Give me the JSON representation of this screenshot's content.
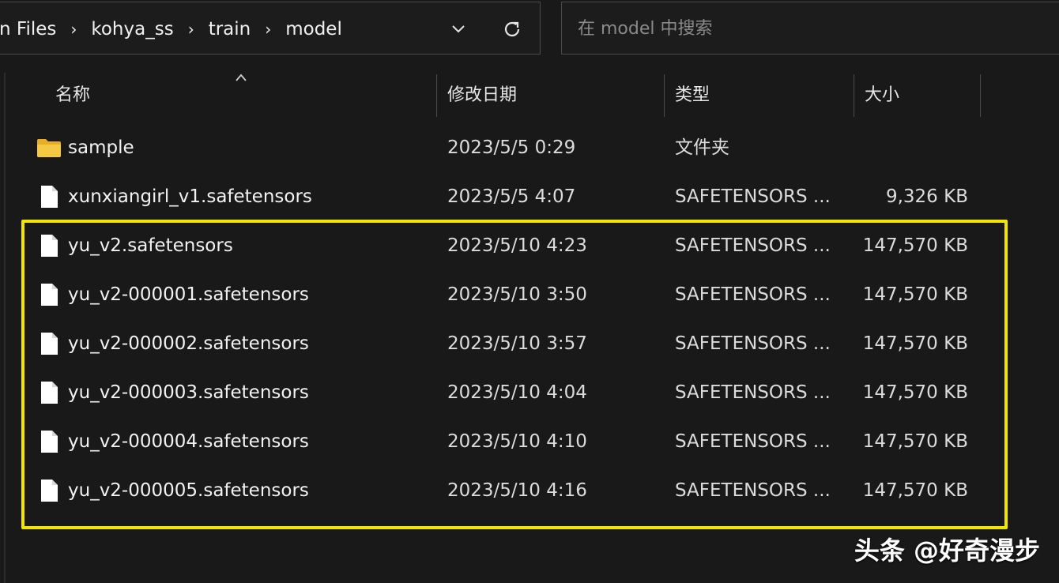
{
  "address": {
    "crumbs": [
      "n Files",
      "kohya_ss",
      "train",
      "model"
    ],
    "separator": "›"
  },
  "search": {
    "placeholder": "在 model 中搜索"
  },
  "columns": {
    "name": "名称",
    "date": "修改日期",
    "type": "类型",
    "size": "大小"
  },
  "files": [
    {
      "name": "sample",
      "date": "2023/5/5 0:29",
      "type": "文件夹",
      "size": "",
      "icon": "folder-icon"
    },
    {
      "name": "xunxiangirl_v1.safetensors",
      "date": "2023/5/5 4:07",
      "type": "SAFETENSORS ...",
      "size": "9,326 KB",
      "icon": "file-icon"
    },
    {
      "name": "yu_v2.safetensors",
      "date": "2023/5/10 4:23",
      "type": "SAFETENSORS ...",
      "size": "147,570 KB",
      "icon": "file-icon"
    },
    {
      "name": "yu_v2-000001.safetensors",
      "date": "2023/5/10 3:50",
      "type": "SAFETENSORS ...",
      "size": "147,570 KB",
      "icon": "file-icon"
    },
    {
      "name": "yu_v2-000002.safetensors",
      "date": "2023/5/10 3:57",
      "type": "SAFETENSORS ...",
      "size": "147,570 KB",
      "icon": "file-icon"
    },
    {
      "name": "yu_v2-000003.safetensors",
      "date": "2023/5/10 4:04",
      "type": "SAFETENSORS ...",
      "size": "147,570 KB",
      "icon": "file-icon"
    },
    {
      "name": "yu_v2-000004.safetensors",
      "date": "2023/5/10 4:10",
      "type": "SAFETENSORS ...",
      "size": "147,570 KB",
      "icon": "file-icon"
    },
    {
      "name": "yu_v2-000005.safetensors",
      "date": "2023/5/10 4:16",
      "type": "SAFETENSORS ...",
      "size": "147,570 KB",
      "icon": "file-icon"
    }
  ],
  "watermark": "头条 @好奇漫步",
  "colors": {
    "highlight": "#f2e600",
    "folder": "#f3c233",
    "background": "#191919"
  }
}
